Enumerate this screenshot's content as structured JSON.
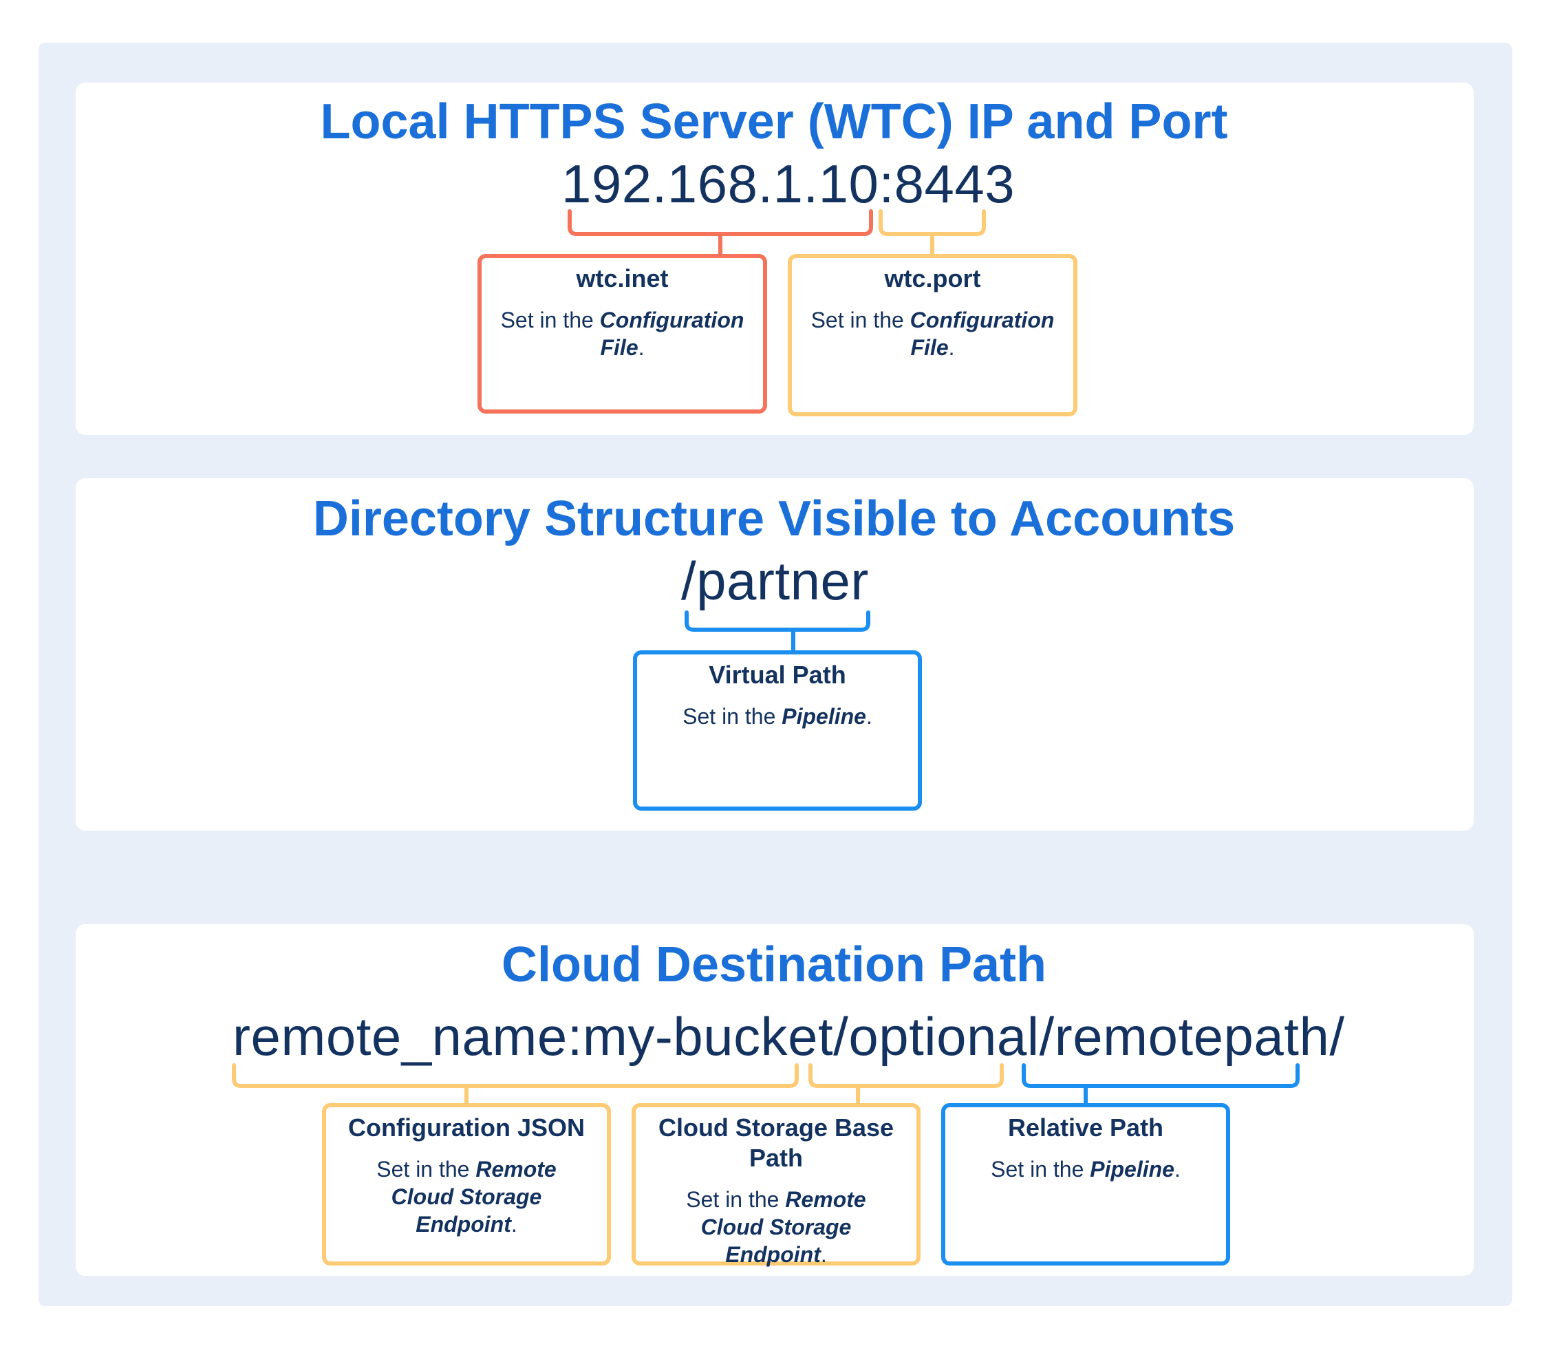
{
  "sections": [
    {
      "title": "Local HTTPS Server (WTC) IP and Port",
      "value_parts": [
        "192.168.1.10",
        ":8443"
      ],
      "boxes": [
        {
          "title": "wtc.inet",
          "desc_prefix": "Set in the ",
          "desc_emphasis": "Configuration File",
          "desc_suffix": ".",
          "color": "#f5735a"
        },
        {
          "title": "wtc.port",
          "desc_prefix": "Set in the ",
          "desc_emphasis": "Configuration File",
          "desc_suffix": ".",
          "color": "#fdcb75"
        }
      ]
    },
    {
      "title": "Directory Structure Visible to Accounts",
      "value": "/partner",
      "boxes": [
        {
          "title": "Virtual Path",
          "desc_prefix": "Set in the ",
          "desc_emphasis": "Pipeline",
          "desc_suffix": ".",
          "color": "#1a8ff0"
        }
      ]
    },
    {
      "title": "Cloud Destination Path",
      "value": "remote_name:my-bucket/optional/remotepath/",
      "boxes": [
        {
          "title": "Configuration JSON",
          "desc_prefix": "Set in the ",
          "desc_emphasis": "Remote Cloud Storage Endpoint",
          "desc_suffix": ".",
          "color": "#fdcb75"
        },
        {
          "title": "Cloud Storage Base Path",
          "desc_prefix": "Set in the ",
          "desc_emphasis": "Remote Cloud Storage Endpoint",
          "desc_suffix": ".",
          "color": "#fdcb75"
        },
        {
          "title": "Relative Path",
          "desc_prefix": "Set in the ",
          "desc_emphasis": "Pipeline",
          "desc_suffix": ".",
          "color": "#1a8ff0"
        }
      ]
    }
  ],
  "colors": {
    "title": "#1b6fd8",
    "text": "#13325f",
    "background": "#e9eff9",
    "red": "#f5735a",
    "yellow": "#fdcb75",
    "blue": "#1a8ff0"
  }
}
